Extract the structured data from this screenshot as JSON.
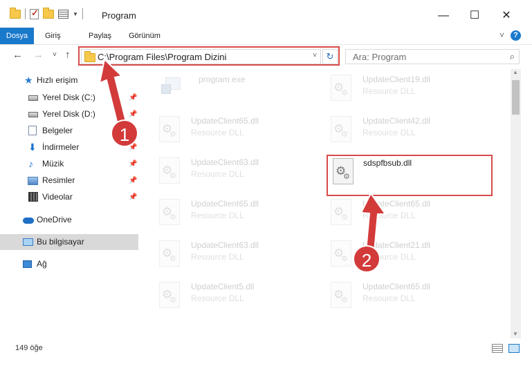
{
  "window": {
    "title": "Program",
    "minimize": "—",
    "maximize": "☐",
    "close": "✕"
  },
  "ribbon": {
    "tabs": [
      {
        "label": "Dosya",
        "active": true
      },
      {
        "label": "Giriş"
      },
      {
        "label": "Paylaş"
      },
      {
        "label": "Görünüm"
      }
    ],
    "help": "?"
  },
  "navigation": {
    "back": "←",
    "forward": "→",
    "recent": "˅",
    "up": "↑",
    "address_path": "C:\\Program Files\\Program Dizini",
    "search_placeholder": "Ara: Program"
  },
  "sidebar": {
    "items": [
      {
        "label": "Hızlı erişim",
        "icon": "star-icon"
      },
      {
        "label": "Yerel Disk (C:)",
        "icon": "drive-icon",
        "pinned": true
      },
      {
        "label": "Yerel Disk (D:)",
        "icon": "drive-icon",
        "pinned": true
      },
      {
        "label": "Belgeler",
        "icon": "documents-icon",
        "pinned": true
      },
      {
        "label": "İndirmeler",
        "icon": "downloads-icon",
        "pinned": true
      },
      {
        "label": "Müzik",
        "icon": "music-icon",
        "pinned": true
      },
      {
        "label": "Resimler",
        "icon": "pictures-icon",
        "pinned": true
      },
      {
        "label": "Videolar",
        "icon": "videos-icon",
        "pinned": true
      },
      {
        "label": "OneDrive",
        "icon": "cloud-icon"
      },
      {
        "label": "Bu bilgisayar",
        "icon": "computer-icon",
        "selected": true
      },
      {
        "label": "Ağ",
        "icon": "network-icon"
      }
    ]
  },
  "files": {
    "left": [
      {
        "name": "program.exe",
        "type": ""
      },
      {
        "name": "UpdateClient65.dll",
        "type": "Resource DLL"
      },
      {
        "name": "UpdateClient63.dll",
        "type": "Resource DLL"
      },
      {
        "name": "UpdateClient65.dll",
        "type": "Resource DLL"
      },
      {
        "name": "UpdateClient63.dll",
        "type": "Resource DLL"
      },
      {
        "name": "UpdateClient5.dll",
        "type": "Resource DLL"
      }
    ],
    "right": [
      {
        "name": "UpdateClient19.dll",
        "type": "Resource DLL"
      },
      {
        "name": "UpdateClient42.dll",
        "type": "Resource DLL"
      },
      {
        "name": "sdspfbsub.dll",
        "type": ""
      },
      {
        "name": "UpdateClient65.dll",
        "type": "Resource DLL"
      },
      {
        "name": "UpdateClient21.dll",
        "type": "Resource DLL"
      },
      {
        "name": "UpdateClient65.dll",
        "type": "Resource DLL"
      }
    ]
  },
  "status": {
    "count": "149 öğe"
  },
  "annotations": {
    "marker1": "1",
    "marker2": "2",
    "color": "#d33a3a"
  }
}
